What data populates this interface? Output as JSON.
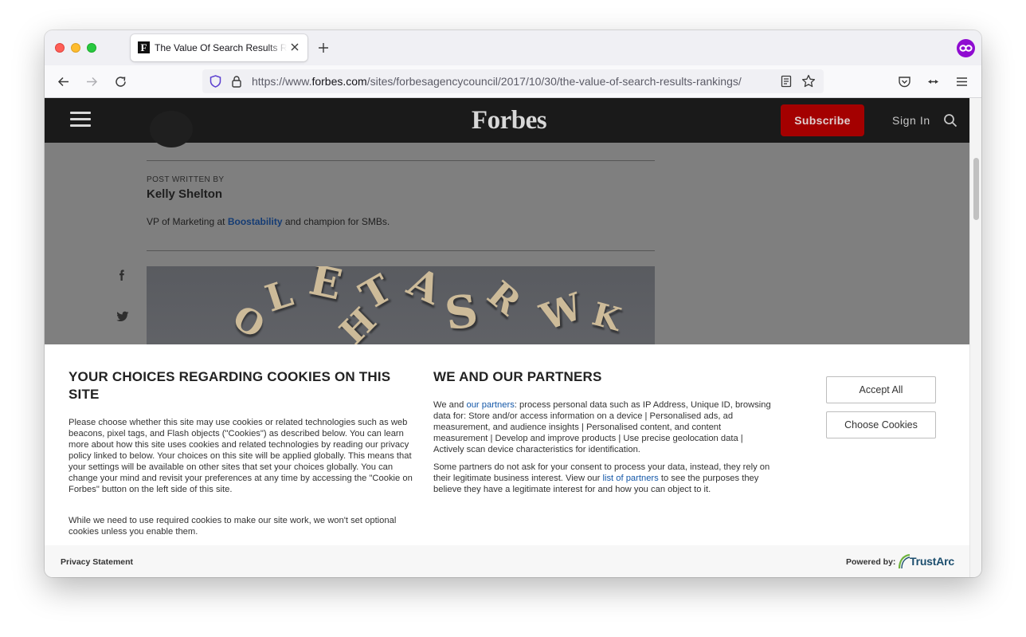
{
  "browser": {
    "tab_title": "The Value Of Search Results Rankings",
    "favicon_letter": "F",
    "url_prefix": "https://www.",
    "url_domain": "forbes.com",
    "url_path": "/sites/forbesagencycouncil/2017/10/30/the-value-of-search-results-rankings/"
  },
  "header": {
    "logo": "Forbes",
    "subscribe": "Subscribe",
    "sign_in": "Sign In"
  },
  "article": {
    "post_label": "POST WRITTEN BY",
    "author": "Kelly Shelton",
    "bio_before": "VP of Marketing at ",
    "bio_link": "Boostability",
    "bio_after": " and champion for SMBs.",
    "social": [
      "f"
    ]
  },
  "cookie": {
    "left_title": "YOUR CHOICES REGARDING COOKIES ON THIS SITE",
    "left_p1": "Please choose whether this site may use cookies or related technologies such as web beacons, pixel tags, and Flash objects (\"Cookies\") as described below. You can learn more about how this site uses cookies and related technologies by reading our privacy policy linked to below. Your choices on this site will be applied globally. This means that your settings will be available on other sites that set your choices globally. You can change your mind and revisit your preferences at any time by accessing the \"Cookie on Forbes\" button on the left side of this site.",
    "left_p2": "While we need to use required cookies to make our site work, we won't set optional cookies unless you enable them.",
    "right_title": "WE AND OUR PARTNERS",
    "right_p1_pre": "We and ",
    "right_p1_link": "our partners",
    "right_p1_post": ": process personal data such as IP Address, Unique ID, browsing data for: Store and/or access information on a device | Personalised ads, ad measurement, and audience insights | Personalised content, and content measurement | Develop and improve products | Use precise geolocation data | Actively scan device characteristics for identification.",
    "right_p2_pre": "Some partners do not ask for your consent to process your data, instead, they rely on their legitimate business interest. View our ",
    "right_p2_link": "list of partners",
    "right_p2_post": " to see the purposes they believe they have a legitimate interest for and how you can object to it.",
    "accept_all": "Accept All",
    "choose_cookies": "Choose Cookies",
    "privacy_statement": "Privacy Statement",
    "powered_by": "Powered by:",
    "trustarc": "TrustArc"
  },
  "colors": {
    "subscribe_bg": "#a40000",
    "link_blue": "#1558a8",
    "extension_purple": "#8f0bd1"
  }
}
